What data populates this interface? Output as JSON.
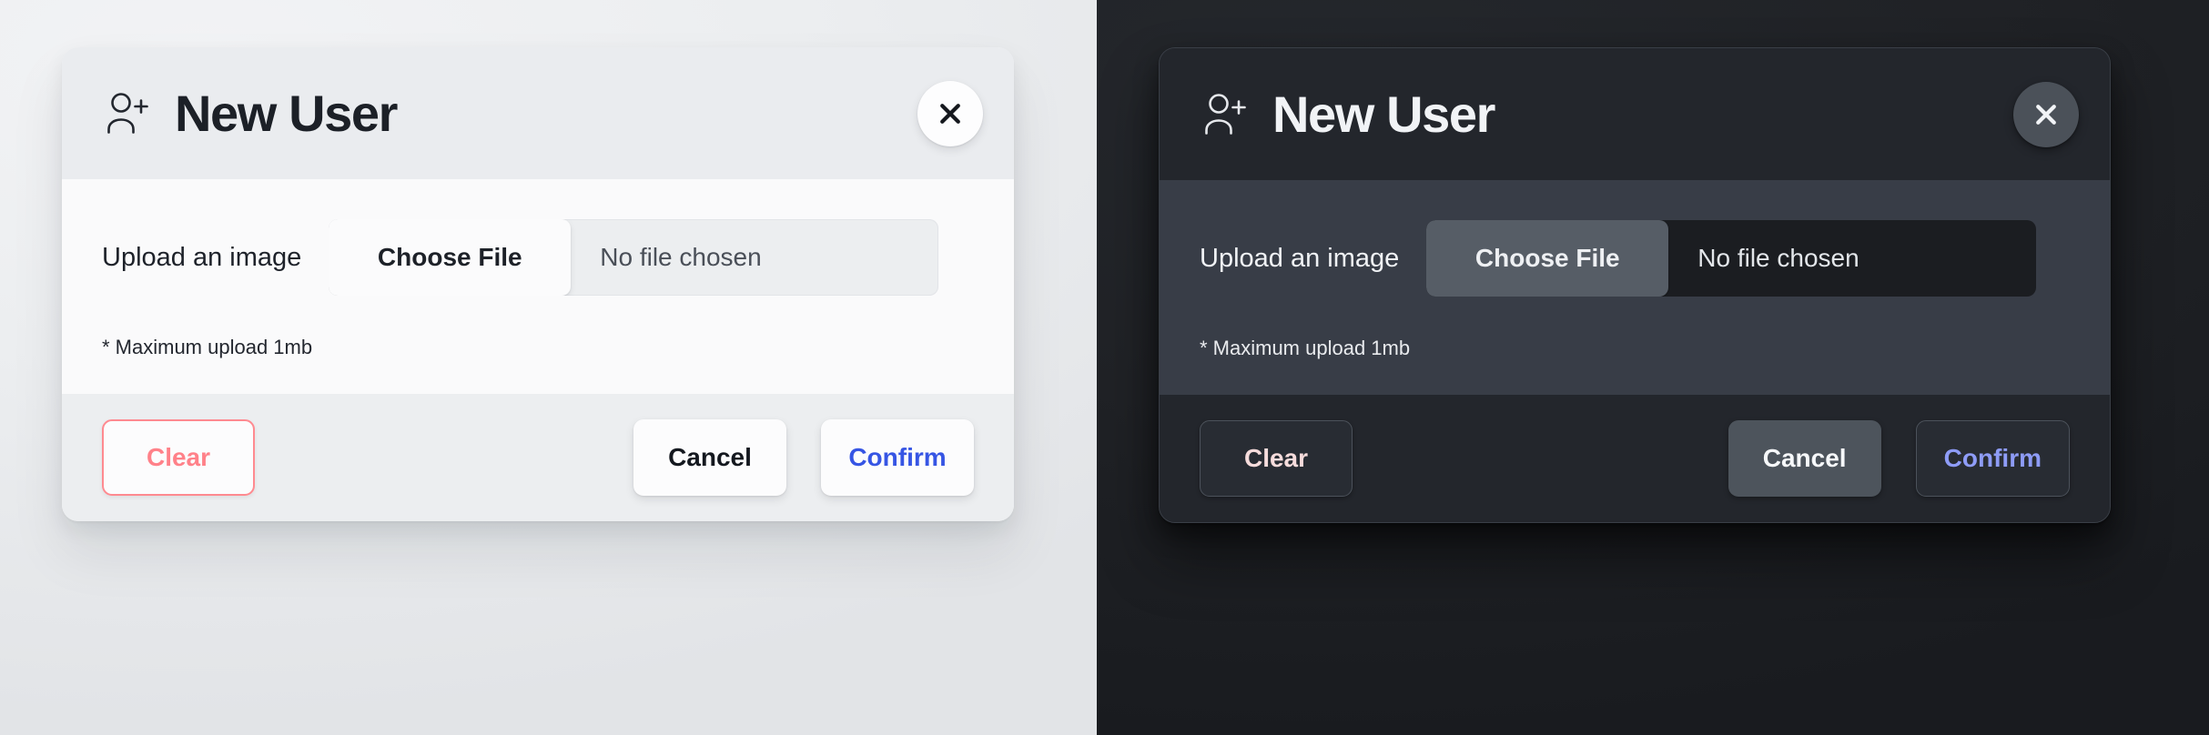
{
  "themes": {
    "light": {
      "name": "light",
      "background": "#ebedf0"
    },
    "dark": {
      "name": "dark",
      "background": "#202227"
    }
  },
  "dialog": {
    "title": "New User",
    "title_icon": "user-add-icon",
    "close_icon": "close-icon",
    "upload_label": "Upload an image",
    "file_input": {
      "button_label": "Choose File",
      "file_name_text": "No file chosen",
      "placeholder": "No file chosen"
    },
    "hint": "* Maximum upload 1mb",
    "buttons": {
      "clear": "Clear",
      "cancel": "Cancel",
      "confirm": "Confirm"
    }
  },
  "colors": {
    "light_clear_text": "#ff8189",
    "light_clear_border": "#ff8a90",
    "light_confirm_text": "#3655e4",
    "light_cancel_text": "#14181f",
    "light_panel_body": "#fafafb",
    "light_panel_chrome": "#eceef0",
    "dark_clear_text": "#f6dcdc",
    "dark_confirm_text": "#8e9cf7",
    "dark_cancel_bg": "#4d545c",
    "dark_panel_body": "#383d47",
    "dark_panel_chrome": "#23262c"
  }
}
